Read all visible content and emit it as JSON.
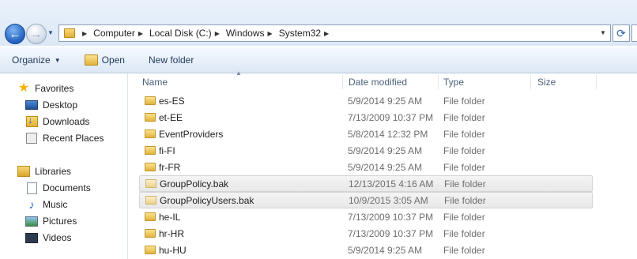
{
  "navigation": {
    "back_glyph": "←",
    "forward_glyph": "→",
    "refresh_glyph": "⟳",
    "breadcrumbs": [
      "Computer",
      "Local Disk (C:)",
      "Windows",
      "System32"
    ]
  },
  "toolbar": {
    "organize_label": "Organize",
    "open_label": "Open",
    "new_folder_label": "New folder"
  },
  "sidebar": {
    "favorites_label": "Favorites",
    "favorites": [
      {
        "label": "Desktop",
        "icon": "desktop-icon"
      },
      {
        "label": "Downloads",
        "icon": "downloads-icon"
      },
      {
        "label": "Recent Places",
        "icon": "recent-places-icon"
      }
    ],
    "libraries_label": "Libraries",
    "libraries": [
      {
        "label": "Documents",
        "icon": "documents-icon"
      },
      {
        "label": "Music",
        "icon": "music-icon"
      },
      {
        "label": "Pictures",
        "icon": "pictures-icon"
      },
      {
        "label": "Videos",
        "icon": "videos-icon"
      }
    ]
  },
  "columns": {
    "name": "Name",
    "date_modified": "Date modified",
    "type": "Type",
    "size": "Size"
  },
  "files": [
    {
      "name": "es-ES",
      "date": "5/9/2014 9:25 AM",
      "type": "File folder",
      "selected": false
    },
    {
      "name": "et-EE",
      "date": "7/13/2009 10:37 PM",
      "type": "File folder",
      "selected": false
    },
    {
      "name": "EventProviders",
      "date": "5/8/2014 12:32 PM",
      "type": "File folder",
      "selected": false
    },
    {
      "name": "fi-FI",
      "date": "5/9/2014 9:25 AM",
      "type": "File folder",
      "selected": false
    },
    {
      "name": "fr-FR",
      "date": "5/9/2014 9:25 AM",
      "type": "File folder",
      "selected": false
    },
    {
      "name": "GroupPolicy.bak",
      "date": "12/13/2015 4:16 AM",
      "type": "File folder",
      "selected": true
    },
    {
      "name": "GroupPolicyUsers.bak",
      "date": "10/9/2015 3:05 AM",
      "type": "File folder",
      "selected": true
    },
    {
      "name": "he-IL",
      "date": "7/13/2009 10:37 PM",
      "type": "File folder",
      "selected": false
    },
    {
      "name": "hr-HR",
      "date": "7/13/2009 10:37 PM",
      "type": "File folder",
      "selected": false
    },
    {
      "name": "hu-HU",
      "date": "5/9/2014 9:25 AM",
      "type": "File folder",
      "selected": false
    }
  ]
}
